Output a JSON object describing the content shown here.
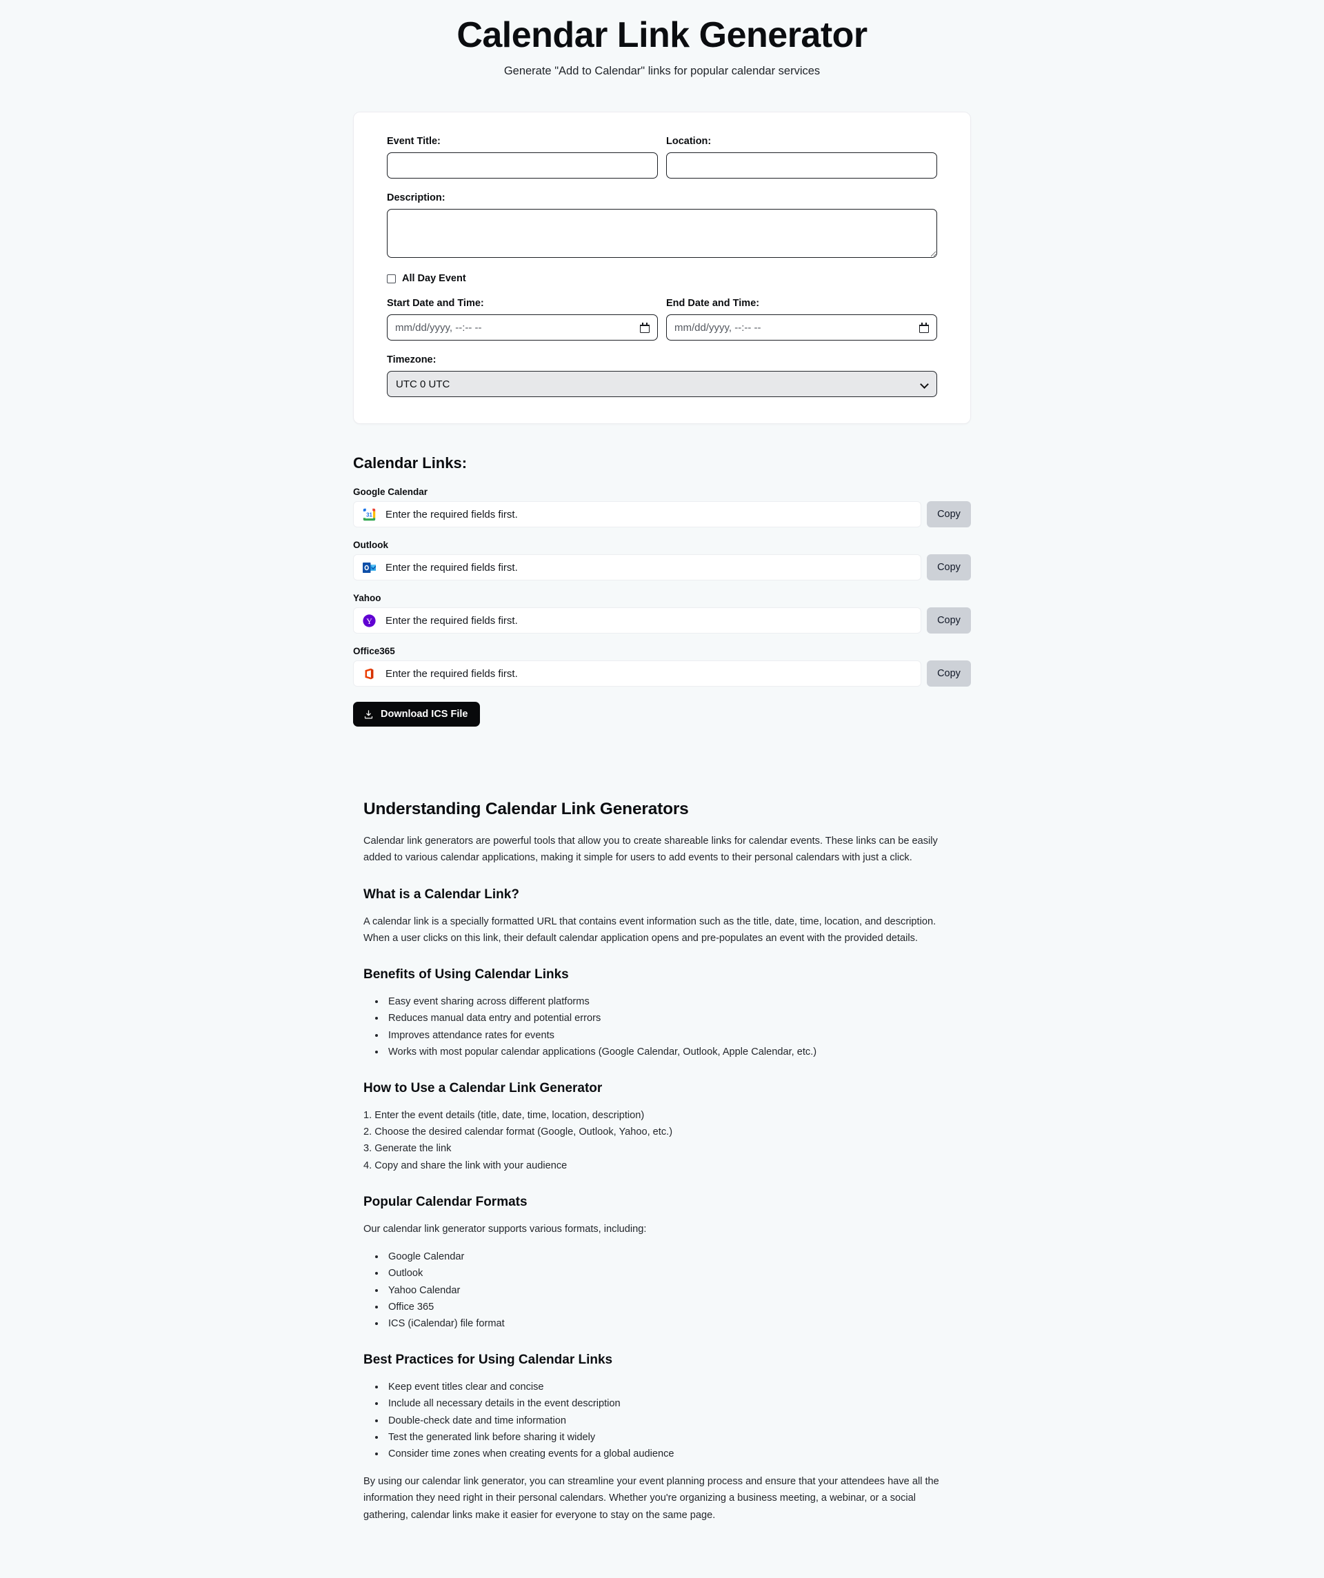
{
  "header": {
    "title": "Calendar Link Generator",
    "subtitle": "Generate \"Add to Calendar\" links for popular calendar services"
  },
  "form": {
    "event_title": {
      "label": "Event Title:",
      "value": "",
      "placeholder": ""
    },
    "location": {
      "label": "Location:",
      "value": "",
      "placeholder": ""
    },
    "description": {
      "label": "Description:",
      "value": "",
      "placeholder": ""
    },
    "all_day": {
      "label": "All Day Event",
      "checked": false
    },
    "start": {
      "label": "Start Date and Time:",
      "value": "",
      "placeholder": "mm/dd/yyyy, --:-- --"
    },
    "end": {
      "label": "End Date and Time:",
      "value": "",
      "placeholder": "mm/dd/yyyy, --:-- --"
    },
    "timezone": {
      "label": "Timezone:",
      "selected": "UTC 0 UTC"
    }
  },
  "links": {
    "heading": "Calendar Links:",
    "copy_label": "Copy",
    "download_label": "Download ICS File",
    "items": [
      {
        "label": "Google Calendar",
        "icon": "google-calendar-icon",
        "value": "Enter the required fields first."
      },
      {
        "label": "Outlook",
        "icon": "outlook-icon",
        "value": "Enter the required fields first."
      },
      {
        "label": "Yahoo",
        "icon": "yahoo-icon",
        "value": "Enter the required fields first."
      },
      {
        "label": "Office365",
        "icon": "office365-icon",
        "value": "Enter the required fields first."
      }
    ]
  },
  "article": {
    "title": "Understanding Calendar Link Generators",
    "intro": "Calendar link generators are powerful tools that allow you to create shareable links for calendar events. These links can be easily added to various calendar applications, making it simple for users to add events to their personal calendars with just a click.",
    "what_heading": "What is a Calendar Link?",
    "what_body": "A calendar link is a specially formatted URL that contains event information such as the title, date, time, location, and description. When a user clicks on this link, their default calendar application opens and pre-populates an event with the provided details.",
    "benefits_heading": "Benefits of Using Calendar Links",
    "benefits": [
      "Easy event sharing across different platforms",
      "Reduces manual data entry and potential errors",
      "Improves attendance rates for events",
      "Works with most popular calendar applications (Google Calendar, Outlook, Apple Calendar, etc.)"
    ],
    "howto_heading": "How to Use a Calendar Link Generator",
    "howto": [
      "1. Enter the event details (title, date, time, location, description)",
      "2. Choose the desired calendar format (Google, Outlook, Yahoo, etc.)",
      "3. Generate the link",
      "4. Copy and share the link with your audience"
    ],
    "formats_heading": "Popular Calendar Formats",
    "formats_intro": "Our calendar link generator supports various formats, including:",
    "formats": [
      "Google Calendar",
      "Outlook",
      "Yahoo Calendar",
      "Office 365",
      "ICS (iCalendar) file format"
    ],
    "best_heading": "Best Practices for Using Calendar Links",
    "best": [
      "Keep event titles clear and concise",
      "Include all necessary details in the event description",
      "Double-check date and time information",
      "Test the generated link before sharing it widely",
      "Consider time zones when creating events for a global audience"
    ],
    "closing": "By using our calendar link generator, you can streamline your event planning process and ensure that your attendees have all the information they need right in their personal calendars. Whether you're organizing a business meeting, a webinar, or a social gathering, calendar links make it easier for everyone to stay on the same page."
  },
  "colors": {
    "page_bg": "#f6f9fa",
    "card_bg": "#ffffff",
    "download_btn_bg": "#08090b",
    "copy_btn_bg": "#cdd1d7",
    "google_blue": "#1a73e8",
    "google_red": "#ea4335",
    "google_yellow": "#fbbc04",
    "google_green": "#34a853",
    "outlook_blue": "#0f4fa8",
    "outlook_light": "#28a8ea",
    "yahoo_purple": "#6001d2",
    "office_red": "#eb3c00"
  }
}
